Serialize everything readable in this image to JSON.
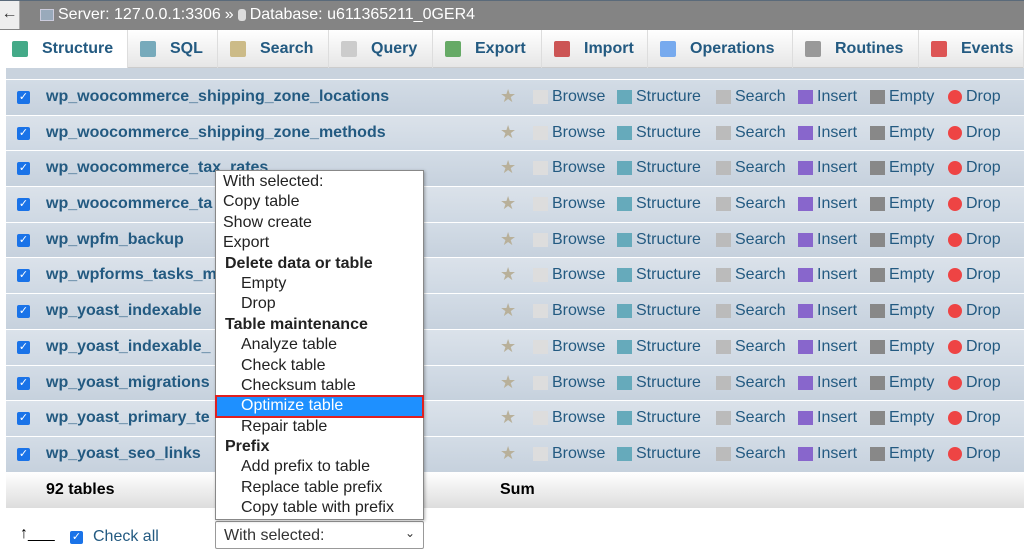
{
  "breadcrumb": {
    "back": "←",
    "server": "Server: 127.0.0.1:3306",
    "sep": "»",
    "database": "Database: u611365211_0GER4"
  },
  "tabs": [
    {
      "label": "Structure",
      "icon": "structure-icon"
    },
    {
      "label": "SQL",
      "icon": "sql-icon"
    },
    {
      "label": "Search",
      "icon": "search-icon"
    },
    {
      "label": "Query",
      "icon": "query-icon"
    },
    {
      "label": "Export",
      "icon": "export-icon"
    },
    {
      "label": "Import",
      "icon": "import-icon"
    },
    {
      "label": "Operations",
      "icon": "wrench-icon"
    },
    {
      "label": "Routines",
      "icon": "gears-icon"
    },
    {
      "label": "Events",
      "icon": "clock-icon"
    }
  ],
  "actions": {
    "browse": "Browse",
    "structure": "Structure",
    "search": "Search",
    "insert": "Insert",
    "empty": "Empty",
    "drop": "Drop"
  },
  "rows": [
    "wp_woocommerce_shipping_zone_locations",
    "wp_woocommerce_shipping_zone_methods",
    "wp_woocommerce_tax_rates",
    "wp_woocommerce_ta",
    "wp_wpfm_backup",
    "wp_wpforms_tasks_m",
    "wp_yoast_indexable",
    "wp_yoast_indexable_",
    "wp_yoast_migrations",
    "wp_yoast_primary_te",
    "wp_yoast_seo_links"
  ],
  "footer": {
    "count": "92 tables",
    "sum": "Sum"
  },
  "bottom": {
    "check_all": "Check all",
    "select_value": "With selected:"
  },
  "menu": [
    {
      "label": "With selected:",
      "type": "item"
    },
    {
      "label": "Copy table",
      "type": "item"
    },
    {
      "label": "Show create",
      "type": "item"
    },
    {
      "label": "Export",
      "type": "item"
    },
    {
      "label": "Delete data or table",
      "type": "grp"
    },
    {
      "label": "Empty",
      "type": "sub"
    },
    {
      "label": "Drop",
      "type": "sub"
    },
    {
      "label": "Table maintenance",
      "type": "grp"
    },
    {
      "label": "Analyze table",
      "type": "sub"
    },
    {
      "label": "Check table",
      "type": "sub"
    },
    {
      "label": "Checksum table",
      "type": "sub"
    },
    {
      "label": "Optimize table",
      "type": "sub sel"
    },
    {
      "label": "Repair table",
      "type": "sub"
    },
    {
      "label": "Prefix",
      "type": "grp"
    },
    {
      "label": "Add prefix to table",
      "type": "sub"
    },
    {
      "label": "Replace table prefix",
      "type": "sub"
    },
    {
      "label": "Copy table with prefix",
      "type": "sub"
    }
  ],
  "colors": {
    "link": "#235a81",
    "highlight": "#1e90ff",
    "highlight_border": "#e02020"
  }
}
